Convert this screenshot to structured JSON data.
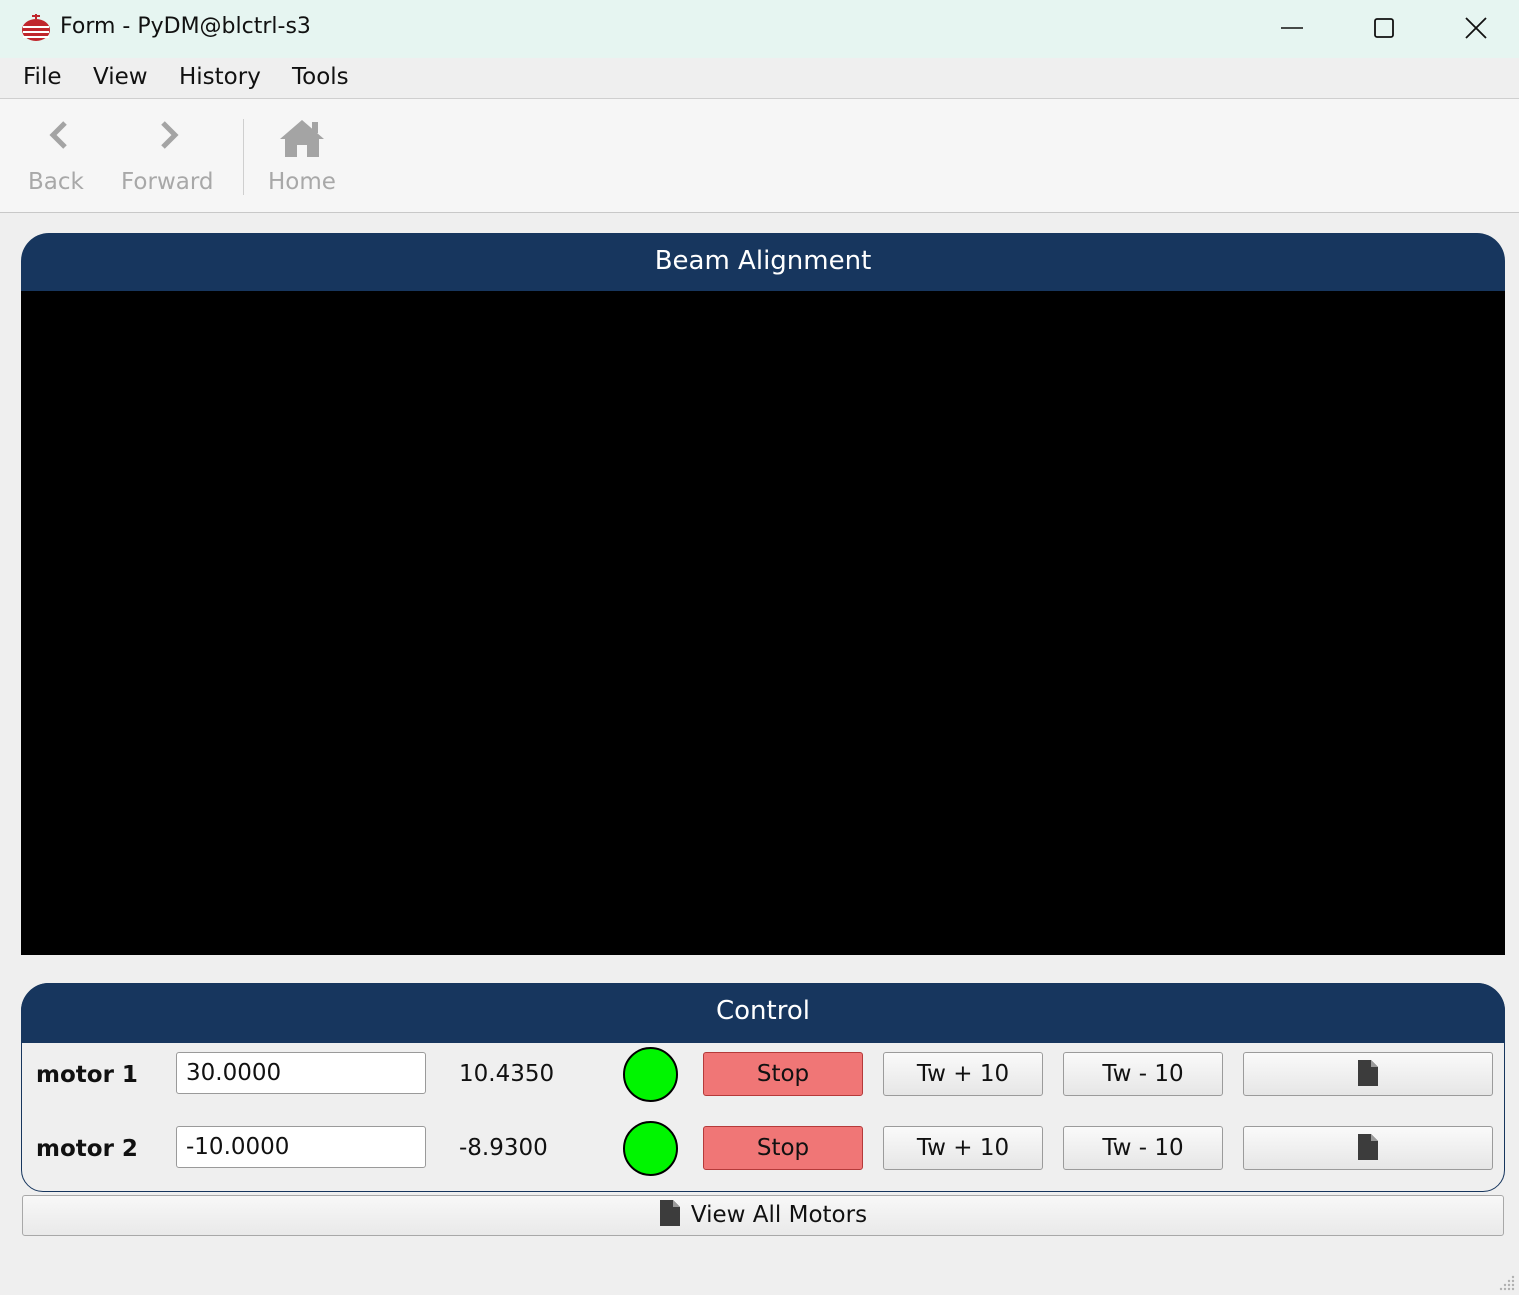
{
  "window": {
    "title": "Form - PyDM@blctrl-s3",
    "icon": "pydm-app-icon",
    "controls": [
      "minimize-icon",
      "maximize-icon",
      "close-icon"
    ]
  },
  "menu": {
    "items": [
      "File",
      "View",
      "History",
      "Tools"
    ]
  },
  "toolbar": {
    "back_label": "Back",
    "forward_label": "Forward",
    "home_label": "Home"
  },
  "beam_alignment": {
    "title": "Beam Alignment"
  },
  "control": {
    "title": "Control",
    "motors": [
      {
        "label": "motor 1",
        "setpoint": "30.0000",
        "readback": "10.4350",
        "status_color": "#00f500",
        "stop_label": "Stop",
        "tweak_plus_label": "Tw + 10",
        "tweak_minus_label": "Tw - 10",
        "details_icon": "document-icon"
      },
      {
        "label": "motor 2",
        "setpoint": "-10.0000",
        "readback": "-8.9300",
        "status_color": "#00f500",
        "stop_label": "Stop",
        "tweak_plus_label": "Tw + 10",
        "tweak_minus_label": "Tw - 10",
        "details_icon": "document-icon"
      }
    ]
  },
  "view_all_button": {
    "label": "View All Motors",
    "icon": "document-icon"
  },
  "colors": {
    "header": "#17365e",
    "stop_button": "#f07676",
    "status_ok": "#00f500",
    "titlebar": "#e6f5f1"
  }
}
